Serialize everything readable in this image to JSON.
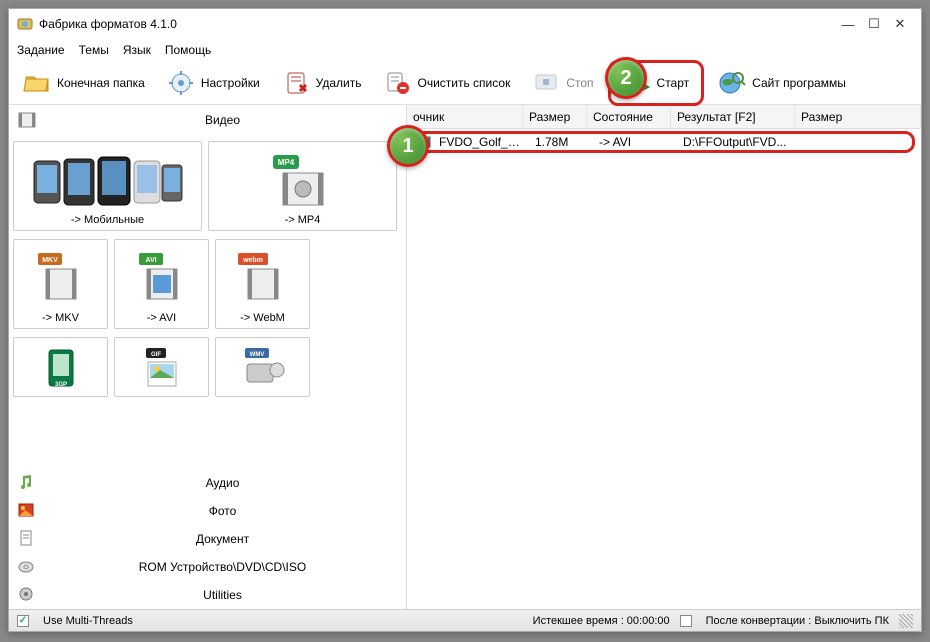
{
  "window": {
    "title": "Фабрика форматов 4.1.0"
  },
  "menu": {
    "task": "Задание",
    "themes": "Темы",
    "lang": "Язык",
    "help": "Помощь"
  },
  "toolbar": {
    "destFolder": "Конечная папка",
    "settings": "Настройки",
    "delete": "Удалить",
    "clearList": "Очистить список",
    "stop": "Стоп",
    "start": "Старт",
    "site": "Сайт программы"
  },
  "categories": {
    "video": "Видео",
    "audio": "Аудио",
    "photo": "Фото",
    "document": "Документ",
    "rom": "ROM Устройство\\DVD\\CD\\ISO",
    "utilities": "Utilities"
  },
  "tiles": [
    {
      "label": "-> Мобильные",
      "fmt": ""
    },
    {
      "label": "-> MP4",
      "fmt": "MP4"
    },
    {
      "label": "-> MKV",
      "fmt": "MKV"
    },
    {
      "label": "-> AVI",
      "fmt": "AVI"
    },
    {
      "label": "-> WebM",
      "fmt": "webm"
    },
    {
      "label": "",
      "fmt": "3GP"
    },
    {
      "label": "",
      "fmt": "GIF"
    },
    {
      "label": "",
      "fmt": "WMV"
    }
  ],
  "listHeader": {
    "source": "очник",
    "sourceFull": "Источник",
    "size": "Размер",
    "state": "Состояние",
    "result": "Результат [F2]",
    "size2": "Размер"
  },
  "rows": [
    {
      "name": "FVDO_Golf_7...",
      "size": "1.78M",
      "state": "-> AVI",
      "result": "D:\\FFOutput\\FVD..."
    }
  ],
  "status": {
    "multiThreads": "Use Multi-Threads",
    "elapsed": "Истекшее время : 00:00:00",
    "afterConvert": "После конвертации : Выключить ПК"
  },
  "annotations": {
    "one": "1",
    "two": "2"
  }
}
